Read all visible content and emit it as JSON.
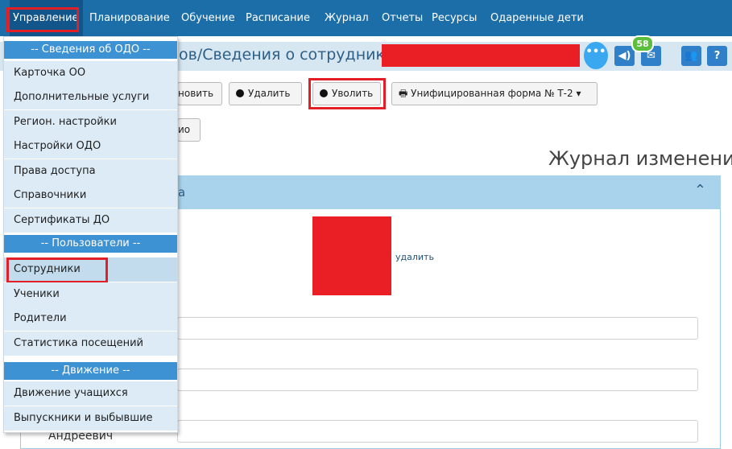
{
  "nav": {
    "items": [
      "Управление",
      "Планирование",
      "Обучение",
      "Расписание",
      "Журнал",
      "Отчеты",
      "Ресурсы",
      "Одаренные дети"
    ]
  },
  "header": {
    "title_visible": "ов/Сведения о сотруднике:",
    "messages_count": "58",
    "help": "?"
  },
  "toolbar": {
    "update_partial": "новить",
    "delete": "Удалить",
    "dismiss": "Уволить",
    "form": "Унифицированная форма № Т-2",
    "second_row_partial": "ио"
  },
  "journal": {
    "title": "Журнал изменений"
  },
  "panel": {
    "header_partial": "а",
    "photo_delete": "удалить",
    "field_value_partial": "Андреевич"
  },
  "menu": {
    "sections": [
      "-- Сведения об ОДО --",
      "-- Пользователи --",
      "-- Движение --"
    ],
    "items": [
      "Карточка ОО",
      "Дополнительные услуги",
      "Регион. настройки",
      "Настройки ОДО",
      "Права доступа",
      "Справочники",
      "Сертификаты ДО",
      "Сотрудники",
      "Ученики",
      "Родители",
      "Статистика посещений",
      "Движение учащихся",
      "Выпускники и выбывшие"
    ]
  },
  "colors": {
    "nav_bg": "#1c6ea8",
    "highlight": "#e21e26",
    "menu_section": "#3d92d3",
    "panel_head": "#a9d3ec"
  }
}
